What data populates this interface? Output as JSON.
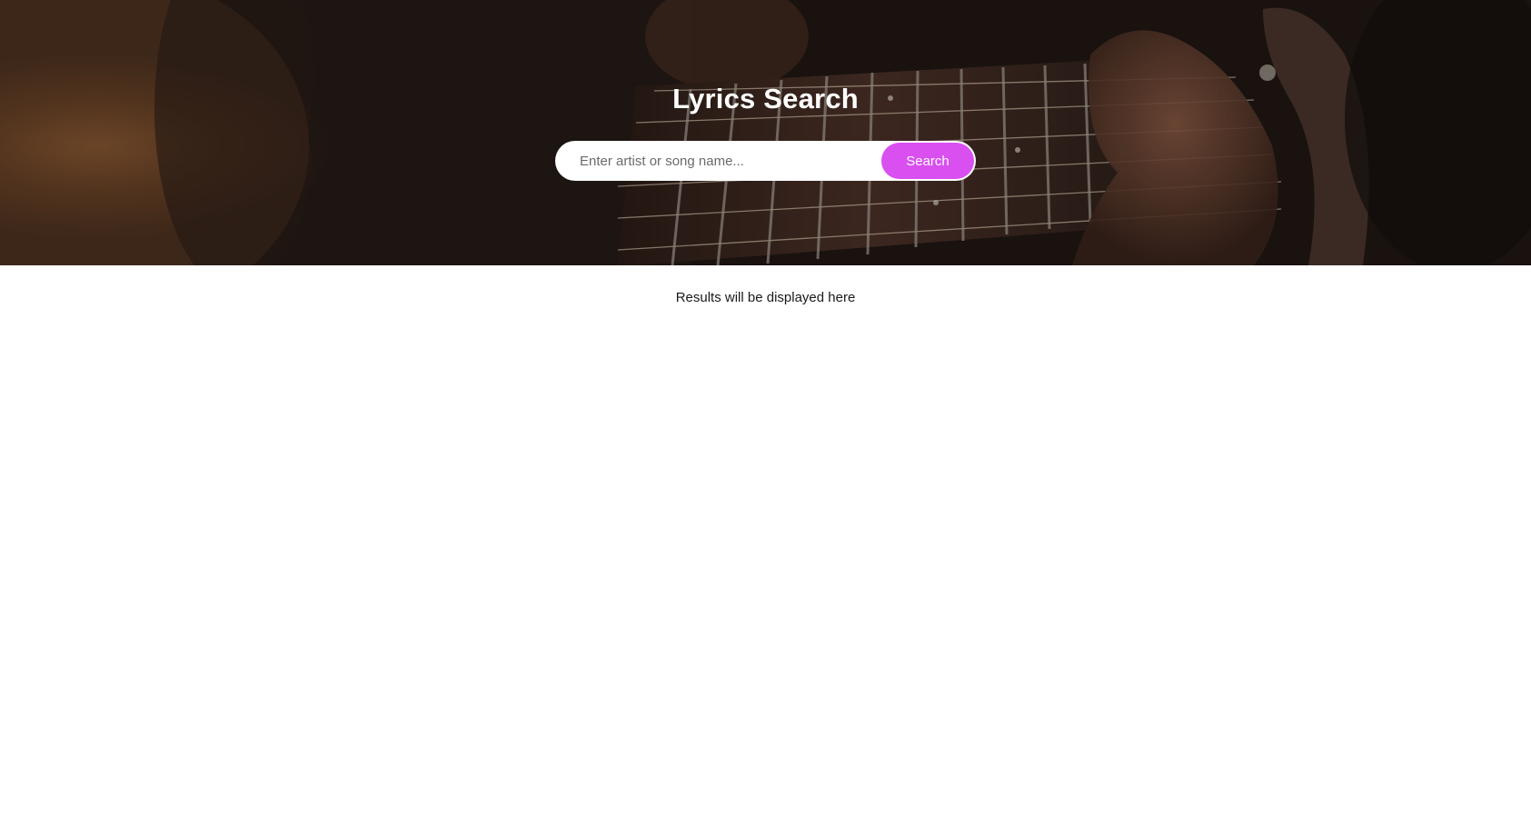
{
  "header": {
    "title": "Lyrics Search"
  },
  "search": {
    "placeholder": "Enter artist or song name...",
    "value": "",
    "button_label": "Search"
  },
  "results": {
    "placeholder_text": "Results will be displayed here"
  },
  "colors": {
    "accent": "#d94ff0",
    "title_text": "#ffffff",
    "body_text": "#1a1a1a",
    "page_background": "#ffffff"
  },
  "icons": {
    "hero_background": "guitar-photo"
  }
}
